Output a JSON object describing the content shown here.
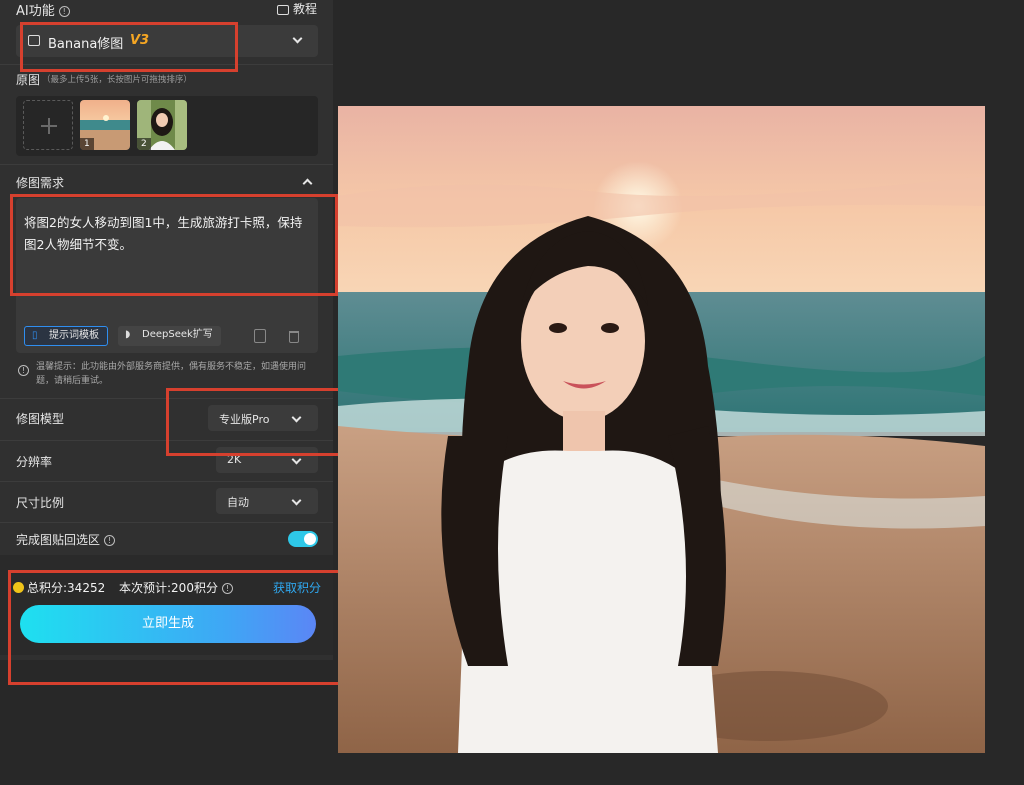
{
  "header": {
    "ai_label": "AI功能",
    "tutorial_label": "教程"
  },
  "feature_select": {
    "name": "Banana修图",
    "version": "V3"
  },
  "source": {
    "label": "原图",
    "hint": "（最多上传5张，长按图片可拖拽排序）",
    "thumbs": [
      {
        "num": "1",
        "desc": "beach"
      },
      {
        "num": "2",
        "desc": "woman"
      }
    ]
  },
  "request": {
    "label": "修图需求",
    "text": "将图2的女人移动到图1中，生成旅游打卡照，保持图2人物细节不变。",
    "template_chip": "提示词模板",
    "deepseek_chip": "DeepSeek扩写"
  },
  "tip": "温馨提示：此功能由外部服务商提供，偶有服务不稳定，如遇使用问题，请稍后重试。",
  "settings": {
    "model_label": "修图模型",
    "model_value": "专业版Pro",
    "resolution_label": "分辨率",
    "resolution_value": "2K",
    "ratio_label": "尺寸比例",
    "ratio_value": "自动",
    "paste_label": "完成图贴回选区",
    "paste_on": true
  },
  "footer": {
    "points": "总积分:34252",
    "estimate": "本次预计:200积分",
    "get_points": "获取积分",
    "generate": "立即生成"
  },
  "colors": {
    "accent": "#2ec8e8",
    "link": "#2fa8f0",
    "highlight": "#d6402e",
    "coin": "#f0c419"
  }
}
